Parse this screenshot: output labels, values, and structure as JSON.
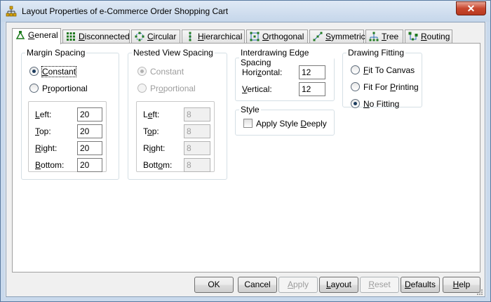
{
  "window": {
    "title": "Layout Properties of e-Commerce Order Shopping Cart",
    "close_symbol": "✕",
    "icon": "hierarchy-app-icon"
  },
  "tabs": [
    {
      "label": "General",
      "hotkey": "G",
      "rest": "eneral",
      "active": true,
      "icon": "general-icon"
    },
    {
      "label": "Disconnected",
      "hotkey": "D",
      "rest": "isconnected",
      "active": false,
      "icon": "disconnected-icon"
    },
    {
      "label": "Circular",
      "hotkey": "C",
      "rest": "ircular",
      "active": false,
      "icon": "circular-icon"
    },
    {
      "label": "Hierarchical",
      "hotkey": "H",
      "rest": "ierarchical",
      "active": false,
      "icon": "hierarchical-icon"
    },
    {
      "label": "Orthogonal",
      "hotkey": "O",
      "rest": "rthogonal",
      "active": false,
      "icon": "orthogonal-icon"
    },
    {
      "label": "Symmetric",
      "hotkey": "S",
      "rest": "ymmetric",
      "active": false,
      "icon": "symmetric-icon"
    },
    {
      "label": "Tree",
      "hotkey": "T",
      "rest": "ree",
      "active": false,
      "icon": "tree-icon"
    },
    {
      "label": "Routing",
      "hotkey": "R",
      "rest": "outing",
      "active": false,
      "icon": "routing-icon"
    }
  ],
  "margin_spacing": {
    "title": "Margin Spacing",
    "constant": {
      "hotkey": "C",
      "rest": "onstant",
      "selected": true
    },
    "proportional": {
      "pre": "P",
      "hotkey": "r",
      "rest": "oportional",
      "selected": false
    },
    "fields": {
      "left": {
        "pre": "",
        "hotkey": "L",
        "rest": "eft:",
        "value": "20"
      },
      "top": {
        "pre": "",
        "hotkey": "T",
        "rest": "op:",
        "value": "20"
      },
      "right": {
        "pre": "",
        "hotkey": "R",
        "rest": "ight:",
        "value": "20"
      },
      "bottom": {
        "pre": "",
        "hotkey": "B",
        "rest": "ottom:",
        "value": "20"
      }
    }
  },
  "nested_view_spacing": {
    "title": "Nested View Spacing",
    "constant": {
      "label": "Constant",
      "selected": true
    },
    "proportional": {
      "pre": "Pr",
      "hotkey": "o",
      "rest": "portional",
      "selected": false
    },
    "fields": {
      "left": {
        "pre": "L",
        "hotkey": "e",
        "rest": "ft:",
        "value": "8"
      },
      "top": {
        "pre": "T",
        "hotkey": "o",
        "rest": "p:",
        "value": "8"
      },
      "right": {
        "pre": "R",
        "hotkey": "i",
        "rest": "ght:",
        "value": "8"
      },
      "bottom": {
        "pre": "Bott",
        "hotkey": "o",
        "rest": "m:",
        "value": "8"
      }
    }
  },
  "interdrawing": {
    "title": "Interdrawing Edge Spacing",
    "horizontal": {
      "pre": "Hori",
      "hotkey": "z",
      "rest": "ontal:",
      "value": "12"
    },
    "vertical": {
      "pre": "",
      "hotkey": "V",
      "rest": "ertical:",
      "value": "12"
    }
  },
  "style": {
    "title": "Style",
    "apply_deeply": {
      "pre": "Apply Style ",
      "hotkey": "D",
      "rest": "eeply",
      "checked": false
    }
  },
  "drawing_fitting": {
    "title": "Drawing Fitting",
    "fit_canvas": {
      "pre": "",
      "hotkey": "F",
      "rest": "it To Canvas",
      "selected": false
    },
    "fit_printing": {
      "pre": "Fit For ",
      "hotkey": "P",
      "rest": "rinting",
      "selected": false
    },
    "no_fitting": {
      "pre": "",
      "hotkey": "N",
      "rest": "o Fitting",
      "selected": true
    }
  },
  "buttons": {
    "ok": "OK",
    "cancel": "Cancel",
    "apply": {
      "pre": "",
      "hotkey": "A",
      "rest": "pply"
    },
    "layout": {
      "pre": "",
      "hotkey": "L",
      "rest": "ayout"
    },
    "reset": {
      "pre": "",
      "hotkey": "R",
      "rest": "eset"
    },
    "defaults": {
      "pre": "",
      "hotkey": "D",
      "rest": "efaults"
    },
    "help": {
      "pre": "",
      "hotkey": "H",
      "rest": "elp"
    }
  }
}
